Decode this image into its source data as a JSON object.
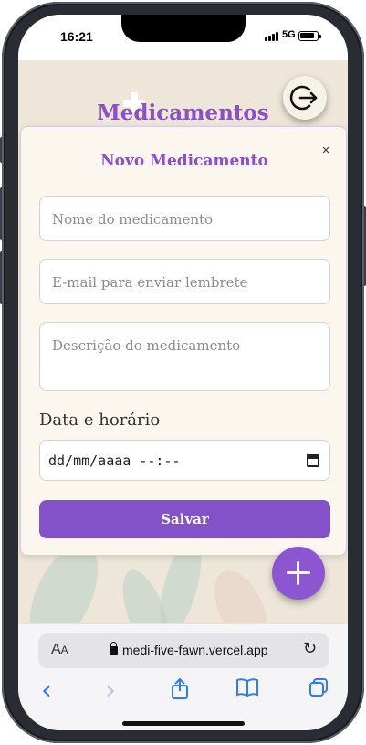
{
  "status_bar": {
    "time": "16:21",
    "network": "5G"
  },
  "header": {
    "title": "Medicamentos",
    "logout_icon": "logout-icon"
  },
  "modal": {
    "title": "Novo Medicamento",
    "close_label": "×",
    "name_placeholder": "Nome do medicamento",
    "email_placeholder": "E-mail para enviar lembrete",
    "description_placeholder": "Descrição do medicamento",
    "date_label": "Data e horário",
    "date_placeholder": "dd/mm/aaaa --:--",
    "save_label": "Salvar"
  },
  "fab": {
    "icon": "plus-icon"
  },
  "browser": {
    "text_size_label": "AA",
    "url": "medi-five-fawn.vercel.app",
    "reload_icon": "↻",
    "back_icon": "‹",
    "forward_icon": "›",
    "share_icon": "share-icon",
    "bookmarks_icon": "book-icon",
    "tabs_icon": "tabs-icon"
  },
  "colors": {
    "accent": "#8452c8",
    "background": "#eee7d9",
    "browser_blue": "#2f7cf6"
  }
}
